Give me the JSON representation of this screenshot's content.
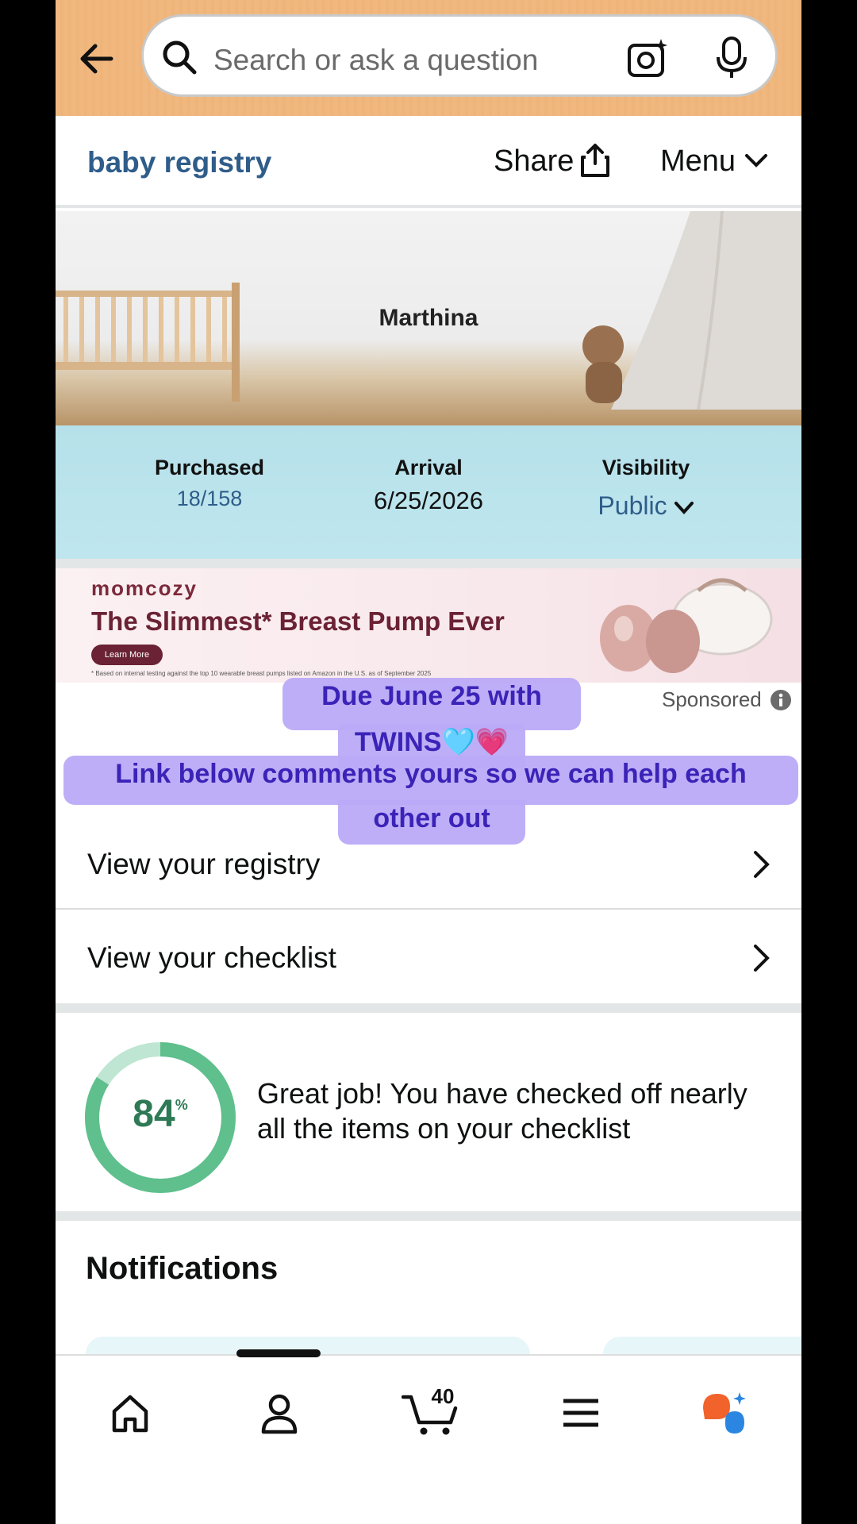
{
  "search": {
    "placeholder": "Search or ask a question"
  },
  "subheader": {
    "brand": "baby registry",
    "share_label": "Share",
    "menu_label": "Menu"
  },
  "hero": {
    "name": "Marthina"
  },
  "stats": {
    "purchased_label": "Purchased",
    "purchased_value": "18/158",
    "arrival_label": "Arrival",
    "arrival_value": "6/25/2026",
    "visibility_label": "Visibility",
    "visibility_value": "Public"
  },
  "ad": {
    "brand": "momcozy",
    "headline": "The Slimmest* Breast Pump Ever",
    "cta": "Learn More",
    "disclaimer": "* Based on internal testing against the top 10 wearable breast pumps listed on Amazon in the U.S. as of September 2025",
    "sponsored": "Sponsored"
  },
  "overlay": {
    "line1": "Due June 25 with",
    "line2": "TWINS",
    "hearts": "🩵💗",
    "line3": "Link below comments yours so we can help each",
    "line4": "other out"
  },
  "links": [
    {
      "label": "View your registry"
    },
    {
      "label": "View your checklist"
    }
  ],
  "checklist": {
    "percent_value": 84,
    "percent": "84",
    "percent_sign": "%",
    "message": "Great job! You have checked off nearly all the items on your checklist"
  },
  "notifications": {
    "title": "Notifications"
  },
  "bottom_nav": {
    "cart_count": "40",
    "items": [
      "home-icon",
      "account-icon",
      "cart-icon",
      "menu-icon",
      "assistant-icon"
    ]
  },
  "colors": {
    "accent_blue": "#2f5d8a",
    "ring_green": "#5fbf8d",
    "ring_light": "#bfe6d2",
    "overlay_purple": "#baaaf7"
  }
}
